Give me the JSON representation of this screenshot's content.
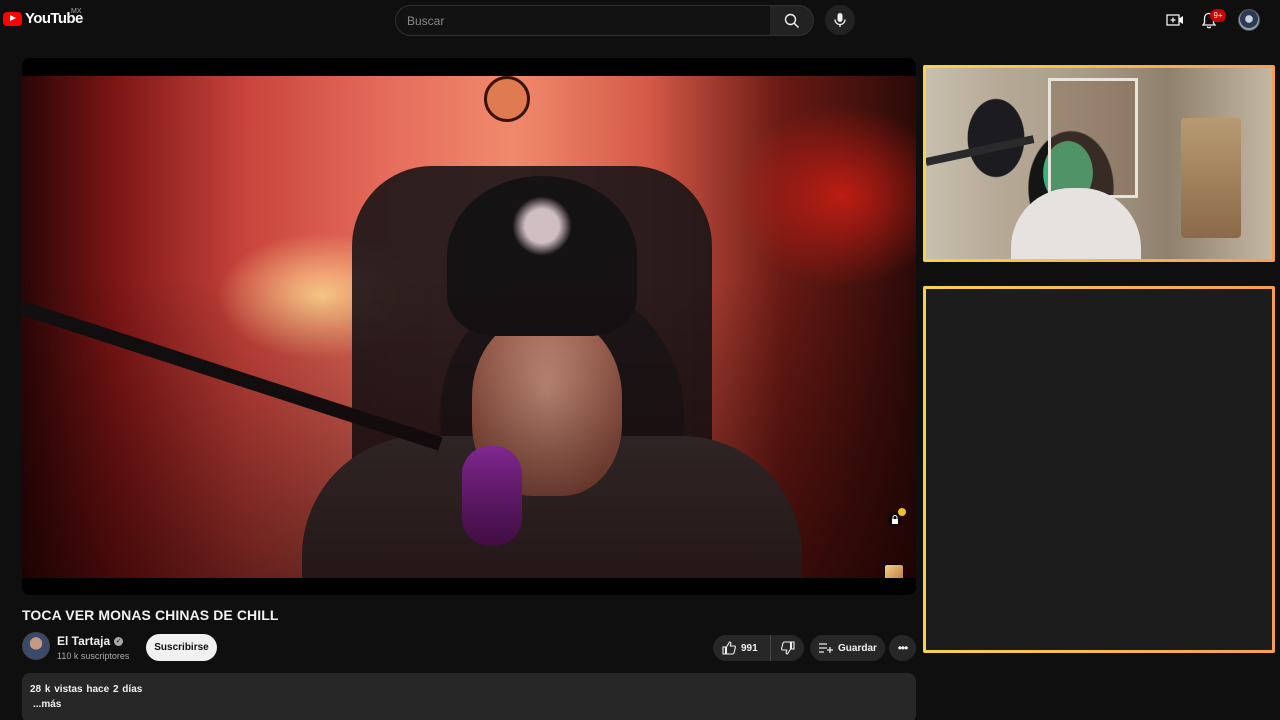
{
  "header": {
    "logo_text": "YouTube",
    "country_code": "MX",
    "search_placeholder": "Buscar",
    "notification_count": "9+"
  },
  "video": {
    "title": "TOCA VER MONAS CHINAS DE CHILL"
  },
  "channel": {
    "name": "El Tartaja",
    "subscribers": "110 k suscriptores",
    "subscribe_label": "Suscribirse"
  },
  "actions": {
    "like_count": "991",
    "save_label": "Guardar",
    "more_label": "•••"
  },
  "description": {
    "views": "28 k vistas",
    "date": "hace 2 días",
    "more": "...más"
  },
  "colors": {
    "background": "#0f0f0f",
    "brand_red": "#ff0000",
    "overlay_border_start": "#f6d34e",
    "overlay_border_end": "#f4a050"
  },
  "icons": [
    "youtube-logo-icon",
    "search-icon",
    "mic-icon",
    "create-icon",
    "bell-icon",
    "verified-icon",
    "like-icon",
    "dislike-icon",
    "save-playlist-icon",
    "more-icon",
    "lock-icon"
  ]
}
